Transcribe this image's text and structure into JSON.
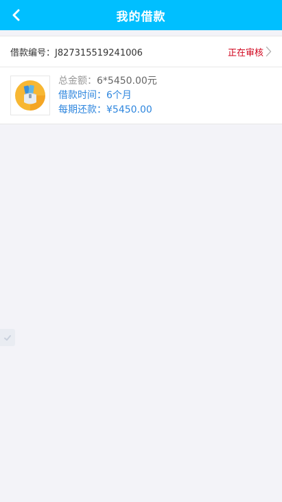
{
  "header": {
    "title": "我的借款",
    "back_icon": "chevron-left-icon",
    "bg_color": "#00bfff"
  },
  "loan": {
    "order_label": "借款编号：",
    "order_number": "J827315519241006",
    "status": "正在审核",
    "status_color": "#d0021b",
    "product_icon": "money-bag-icon",
    "total_label": "总金额：",
    "total_value": "6*5450.00元",
    "term_label": "借款时间：",
    "term_value": "6个月",
    "installment_label": "每期还款：",
    "installment_value": "¥5450.00"
  },
  "float_tab": {
    "icon": "check-icon"
  }
}
